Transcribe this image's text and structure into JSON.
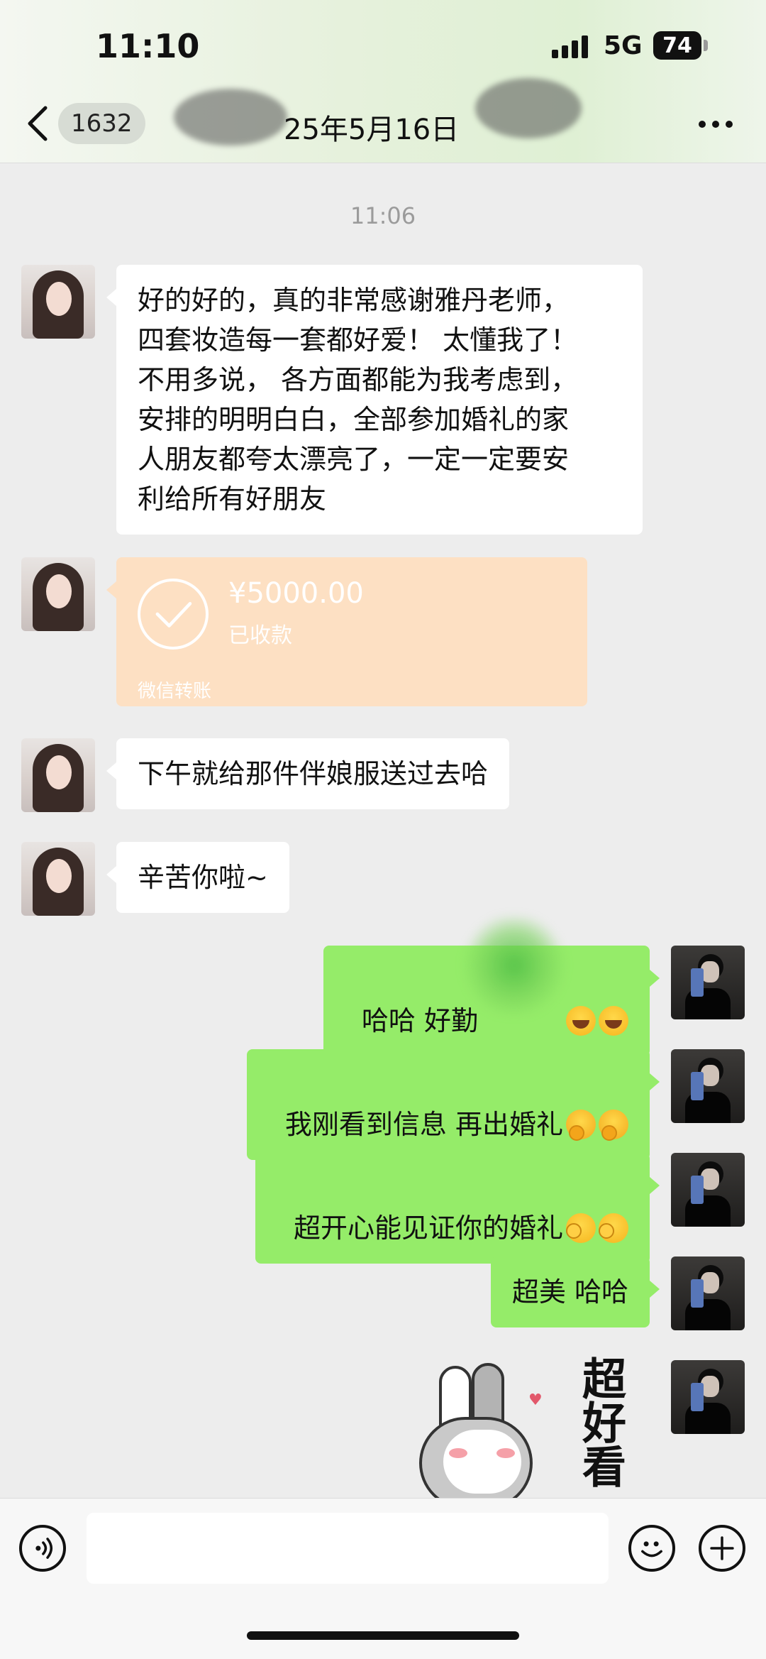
{
  "status_bar": {
    "time": "11:10",
    "network": "5G",
    "battery": "74"
  },
  "header": {
    "unread_count": "1632",
    "title": "25年5月16日"
  },
  "chat": {
    "timestamp": "11:06",
    "messages": [
      {
        "side": "left",
        "text": "好的好的，真的非常感谢雅丹老师，\n四套妆造每一套都好爱！ 太懂我了！\n不用多说， 各方面都能为我考虑到，\n安排的明明白白，全部参加婚礼的家\n人朋友都夸太漂亮了，一定一定要安\n利给所有好朋友"
      },
      {
        "side": "left",
        "text": "下午就给那件伴娘服送过去哈"
      },
      {
        "side": "left",
        "text": "辛苦你啦~"
      },
      {
        "side": "right",
        "text": "哈哈 好勤"
      },
      {
        "side": "right",
        "text": "我刚看到信息 再出婚礼"
      },
      {
        "side": "right",
        "text": "超开心能见证你的婚礼"
      },
      {
        "side": "right",
        "text": "超美 哈哈"
      }
    ],
    "transfer": {
      "amount": "¥5000.00",
      "status": "已收款",
      "label": "微信转账"
    },
    "sticker_text": "超好看"
  },
  "icons": {
    "back": "chevron-left-icon",
    "more": "more-dots-icon",
    "voice": "voice-icon",
    "emoji": "smile-icon",
    "plus": "plus-icon",
    "check": "check-circle-icon"
  },
  "colors": {
    "accent": "#95ec69",
    "transfer": "#fde0c3",
    "background": "#ededed"
  }
}
